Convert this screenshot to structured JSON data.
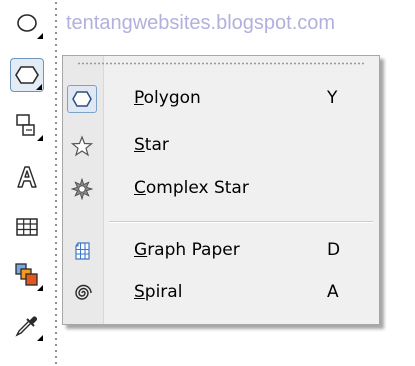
{
  "watermark": "tentangwebsites.blogspot.com",
  "toolbox": {
    "tools": [
      {
        "name": "ellipse-tool",
        "icon": "ellipse-icon"
      },
      {
        "name": "polygon-tool",
        "icon": "polygon-icon",
        "active": true
      },
      {
        "name": "basic-shapes-tool",
        "icon": "basic-shapes-icon"
      },
      {
        "name": "text-tool",
        "icon": "text-a-icon"
      },
      {
        "name": "table-tool",
        "icon": "table-icon"
      },
      {
        "name": "interactive-fill-tool",
        "icon": "interactive-fill-icon"
      },
      {
        "name": "eyedropper-tool",
        "icon": "eyedropper-icon"
      }
    ]
  },
  "flyout": {
    "items": [
      {
        "label_ul": "P",
        "label_rest": "olygon",
        "shortcut": "Y",
        "icon": "polygon-icon",
        "checked": true
      },
      {
        "label_ul": "S",
        "label_rest": "tar",
        "shortcut": "",
        "icon": "star-icon"
      },
      {
        "label_ul": "C",
        "label_rest": "omplex Star",
        "shortcut": "",
        "icon": "complex-star-icon"
      },
      {
        "label_ul": "G",
        "label_rest": "raph Paper",
        "shortcut": "D",
        "icon": "graph-paper-icon"
      },
      {
        "label_ul": "S",
        "label_rest": "piral",
        "shortcut": "A",
        "icon": "spiral-icon"
      }
    ]
  },
  "colors": {
    "watermark": "#b2b0dd",
    "active_border": "#6d95bd",
    "active_fill": "#e3ecf5",
    "icon_blue": "#3d78c8",
    "icon_orange": "#f39a1f"
  }
}
